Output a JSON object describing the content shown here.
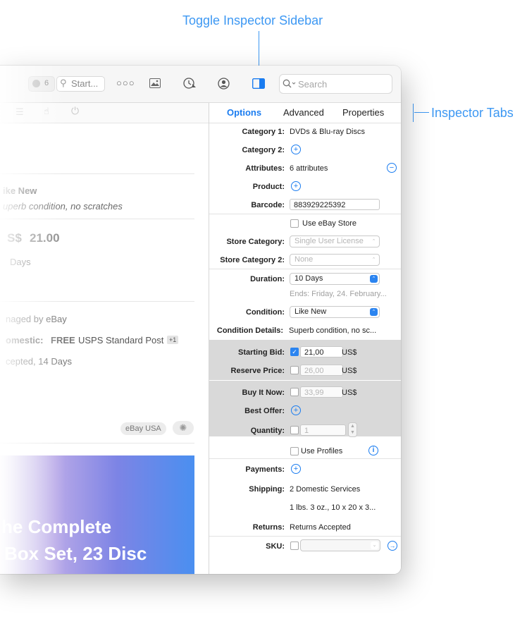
{
  "callouts": {
    "toggle_inspector": "Toggle Inspector Sidebar",
    "inspector_tabs": "Inspector Tabs"
  },
  "toolbar": {
    "badge_count": "6",
    "start_label": "Start...",
    "search_placeholder": "Search"
  },
  "left": {
    "condition": "ike New",
    "condition_detail": "uperb condition, no scratches",
    "currency": "S$",
    "price": "21.00",
    "duration": "Days",
    "managed": "naged by eBay",
    "domestic_label": "omestic:",
    "free": "FREE",
    "shipping_service": "USPS Standard Post",
    "plus_more": "+1",
    "returns": "cepted, 14 Days",
    "site_badge": "eBay USA",
    "banner_line1": "he Complete",
    "banner_line2": "Box Set, 23 Disc"
  },
  "inspector": {
    "tabs": [
      "Options",
      "Advanced",
      "Properties"
    ],
    "category1_label": "Category 1:",
    "category1_value": "DVDs & Blu-ray Discs",
    "category2_label": "Category 2:",
    "attributes_label": "Attributes:",
    "attributes_value": "6 attributes",
    "product_label": "Product:",
    "barcode_label": "Barcode:",
    "barcode_value": "883929225392",
    "use_ebay_store": "Use eBay Store",
    "store_category_label": "Store Category:",
    "store_category_value": "Single User License",
    "store_category2_label": "Store Category 2:",
    "store_category2_value": "None",
    "duration_label": "Duration:",
    "duration_value": "10 Days",
    "ends": "Ends: Friday, 24. February...",
    "condition_label": "Condition:",
    "condition_value": "Like New",
    "condition_details_label": "Condition Details:",
    "condition_details_value": "Superb condition, no sc...",
    "starting_bid_label": "Starting Bid:",
    "starting_bid_value": "21,00",
    "currency": "US$",
    "reserve_price_label": "Reserve Price:",
    "reserve_price_value": "26,00",
    "buy_it_now_label": "Buy It Now:",
    "buy_it_now_value": "33,99",
    "best_offer_label": "Best Offer:",
    "quantity_label": "Quantity:",
    "quantity_value": "1",
    "use_profiles": "Use Profiles",
    "payments_label": "Payments:",
    "shipping_label": "Shipping:",
    "shipping_value1": "2 Domestic Services",
    "shipping_value2": "1 lbs. 3 oz., 10 x 20 x 3...",
    "returns_label": "Returns:",
    "returns_value": "Returns Accepted",
    "sku_label": "SKU:"
  }
}
